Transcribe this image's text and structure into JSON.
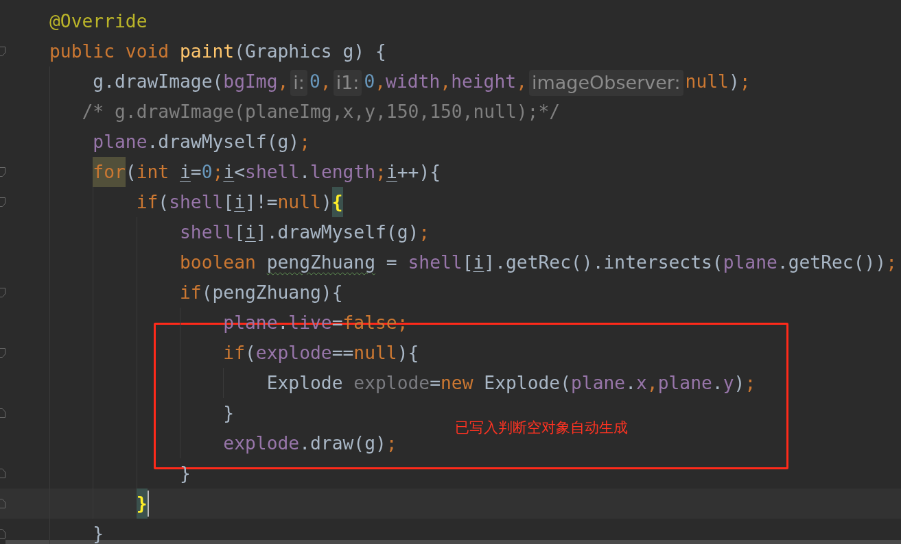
{
  "editor": {
    "lines": [
      {
        "kind": "code",
        "current": false,
        "tokens": [
          {
            "kind": "annotation",
            "text": "@Override"
          }
        ]
      },
      {
        "kind": "code",
        "current": false,
        "tokens": [
          {
            "kind": "keyword",
            "text": "public void "
          },
          {
            "kind": "method",
            "text": "paint"
          },
          {
            "kind": "plain",
            "text": "(Graphics g) {"
          }
        ],
        "children": [
          {
            "kind": "code",
            "current": false,
            "tokens": [
              {
                "kind": "plain",
                "text": "g.drawImage("
              },
              {
                "kind": "field",
                "text": "bgImg"
              },
              {
                "kind": "keyword",
                "text": ","
              },
              {
                "kind": "hint",
                "text": "i:"
              },
              {
                "kind": "number",
                "text": "0"
              },
              {
                "kind": "keyword",
                "text": ","
              },
              {
                "kind": "hint",
                "text": "i1:"
              },
              {
                "kind": "number",
                "text": "0"
              },
              {
                "kind": "keyword",
                "text": ","
              },
              {
                "kind": "field",
                "text": "width"
              },
              {
                "kind": "keyword",
                "text": ","
              },
              {
                "kind": "field",
                "text": "height"
              },
              {
                "kind": "keyword",
                "text": ","
              },
              {
                "kind": "hint",
                "text": "imageObserver:"
              },
              {
                "kind": "keyword",
                "text": "null"
              },
              {
                "kind": "plain",
                "text": ")"
              },
              {
                "kind": "keyword",
                "text": ";"
              }
            ]
          },
          {
            "kind": "comment",
            "current": false,
            "tokens": [
              {
                "kind": "comment",
                "text": "/* g.drawImage(planeImg,x,y,150,150,null);*/"
              }
            ]
          },
          {
            "kind": "code",
            "current": false,
            "tokens": [
              {
                "kind": "field",
                "text": "plane"
              },
              {
                "kind": "plain",
                "text": ".drawMyself(g)"
              },
              {
                "kind": "keyword",
                "text": ";"
              }
            ]
          },
          {
            "kind": "code",
            "current": false,
            "tokens": [
              {
                "kind": "usage",
                "text": "for"
              },
              {
                "kind": "plain",
                "text": "("
              },
              {
                "kind": "keyword",
                "text": "int "
              },
              {
                "kind": "reassigned",
                "text": "i"
              },
              {
                "kind": "plain",
                "text": "="
              },
              {
                "kind": "number",
                "text": "0"
              },
              {
                "kind": "keyword",
                "text": ";"
              },
              {
                "kind": "reassigned",
                "text": "i"
              },
              {
                "kind": "plain",
                "text": "<"
              },
              {
                "kind": "field",
                "text": "shell"
              },
              {
                "kind": "plain",
                "text": "."
              },
              {
                "kind": "field",
                "text": "length"
              },
              {
                "kind": "keyword",
                "text": ";"
              },
              {
                "kind": "reassigned",
                "text": "i"
              },
              {
                "kind": "plain",
                "text": "++){"
              }
            ],
            "children": [
              {
                "kind": "code",
                "current": false,
                "tokens": [
                  {
                    "kind": "keyword",
                    "text": "if"
                  },
                  {
                    "kind": "plain",
                    "text": "("
                  },
                  {
                    "kind": "field",
                    "text": "shell"
                  },
                  {
                    "kind": "plain",
                    "text": "["
                  },
                  {
                    "kind": "reassigned",
                    "text": "i"
                  },
                  {
                    "kind": "plain",
                    "text": "]!="
                  },
                  {
                    "kind": "keyword",
                    "text": "null"
                  },
                  {
                    "kind": "plain",
                    "text": ")"
                  },
                  {
                    "kind": "brace",
                    "text": "{"
                  }
                ],
                "children": [
                  {
                    "kind": "code",
                    "current": false,
                    "tokens": [
                      {
                        "kind": "field",
                        "text": "shell"
                      },
                      {
                        "kind": "plain",
                        "text": "["
                      },
                      {
                        "kind": "reassigned",
                        "text": "i"
                      },
                      {
                        "kind": "plain",
                        "text": "].drawMyself(g)"
                      },
                      {
                        "kind": "keyword",
                        "text": ";"
                      }
                    ]
                  },
                  {
                    "kind": "code",
                    "current": false,
                    "tokens": [
                      {
                        "kind": "keyword",
                        "text": "boolean "
                      },
                      {
                        "kind": "typo",
                        "text": "pengZhuang"
                      },
                      {
                        "kind": "plain",
                        "text": " = "
                      },
                      {
                        "kind": "field",
                        "text": "shell"
                      },
                      {
                        "kind": "plain",
                        "text": "["
                      },
                      {
                        "kind": "reassigned",
                        "text": "i"
                      },
                      {
                        "kind": "plain",
                        "text": "].getRec().intersects("
                      },
                      {
                        "kind": "field",
                        "text": "plane"
                      },
                      {
                        "kind": "plain",
                        "text": ".getRec())"
                      },
                      {
                        "kind": "keyword",
                        "text": ";"
                      }
                    ]
                  },
                  {
                    "kind": "code",
                    "current": false,
                    "tokens": [
                      {
                        "kind": "keyword",
                        "text": "if"
                      },
                      {
                        "kind": "plain",
                        "text": "(pengZhuang){"
                      }
                    ],
                    "children": [
                      {
                        "kind": "code",
                        "current": false,
                        "tokens": [
                          {
                            "kind": "field",
                            "text": "plane"
                          },
                          {
                            "kind": "plain",
                            "text": "."
                          },
                          {
                            "kind": "field",
                            "text": "live"
                          },
                          {
                            "kind": "plain",
                            "text": "="
                          },
                          {
                            "kind": "keyword",
                            "text": "false;"
                          }
                        ]
                      },
                      {
                        "kind": "code",
                        "current": false,
                        "tokens": [
                          {
                            "kind": "keyword",
                            "text": "if"
                          },
                          {
                            "kind": "plain",
                            "text": "("
                          },
                          {
                            "kind": "field",
                            "text": "explode"
                          },
                          {
                            "kind": "plain",
                            "text": "=="
                          },
                          {
                            "kind": "keyword",
                            "text": "null"
                          },
                          {
                            "kind": "plain",
                            "text": "){"
                          }
                        ],
                        "children": [
                          {
                            "kind": "code",
                            "current": false,
                            "tokens": [
                              {
                                "kind": "plain",
                                "text": "Explode "
                              },
                              {
                                "kind": "unused",
                                "text": "explode"
                              },
                              {
                                "kind": "plain",
                                "text": "="
                              },
                              {
                                "kind": "keyword",
                                "text": "new"
                              },
                              {
                                "kind": "plain",
                                "text": " Explode("
                              },
                              {
                                "kind": "field",
                                "text": "plane"
                              },
                              {
                                "kind": "plain",
                                "text": "."
                              },
                              {
                                "kind": "field",
                                "text": "x"
                              },
                              {
                                "kind": "keyword",
                                "text": ","
                              },
                              {
                                "kind": "field",
                                "text": "plane"
                              },
                              {
                                "kind": "plain",
                                "text": "."
                              },
                              {
                                "kind": "field",
                                "text": "y"
                              },
                              {
                                "kind": "plain",
                                "text": ")"
                              },
                              {
                                "kind": "keyword",
                                "text": ";"
                              }
                            ]
                          }
                        ]
                      },
                      {
                        "kind": "close",
                        "current": false,
                        "tokens": [
                          {
                            "kind": "plain",
                            "text": "}"
                          }
                        ]
                      },
                      {
                        "kind": "code",
                        "current": false,
                        "tokens": [
                          {
                            "kind": "field",
                            "text": "explode"
                          },
                          {
                            "kind": "plain",
                            "text": ".draw(g)"
                          },
                          {
                            "kind": "keyword",
                            "text": ";"
                          }
                        ]
                      }
                    ]
                  },
                  {
                    "kind": "close",
                    "current": false,
                    "tokens": [
                      {
                        "kind": "plain",
                        "text": "}"
                      }
                    ]
                  }
                ]
              },
              {
                "kind": "close",
                "current": true,
                "tokens": [
                  {
                    "kind": "brace",
                    "text": "}"
                  }
                ]
              }
            ]
          },
          {
            "kind": "close",
            "current": false,
            "tokens": [
              {
                "kind": "plain",
                "text": "}"
              }
            ]
          }
        ]
      }
    ],
    "annotation": {
      "note": "已写入判断空对象自动生成"
    }
  }
}
